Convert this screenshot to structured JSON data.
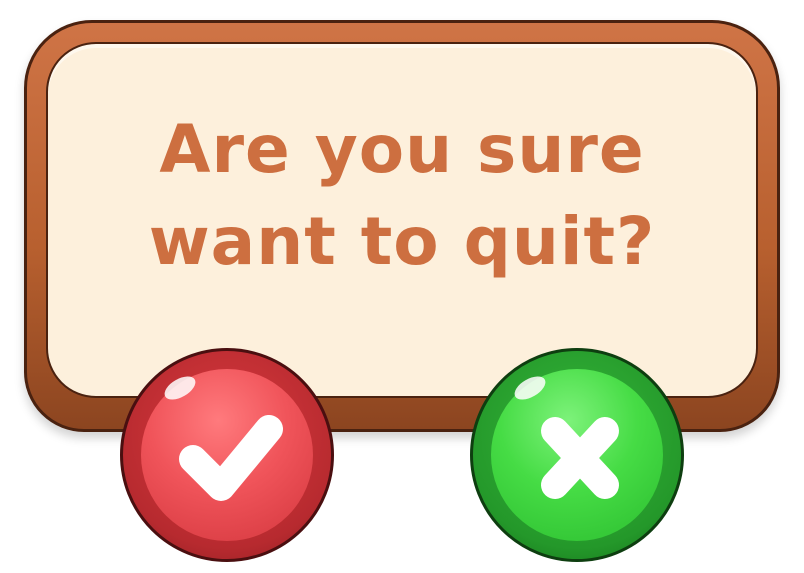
{
  "dialog": {
    "question_line1": "Are you sure",
    "question_line2": "want to quit?"
  },
  "buttons": {
    "confirm_icon": "checkmark-icon",
    "cancel_icon": "x-icon"
  },
  "colors": {
    "frame": "#b8602f",
    "panel": "#fdf0dc",
    "text": "#cd6f40",
    "confirm": "#e0434a",
    "cancel": "#3fcf40"
  }
}
